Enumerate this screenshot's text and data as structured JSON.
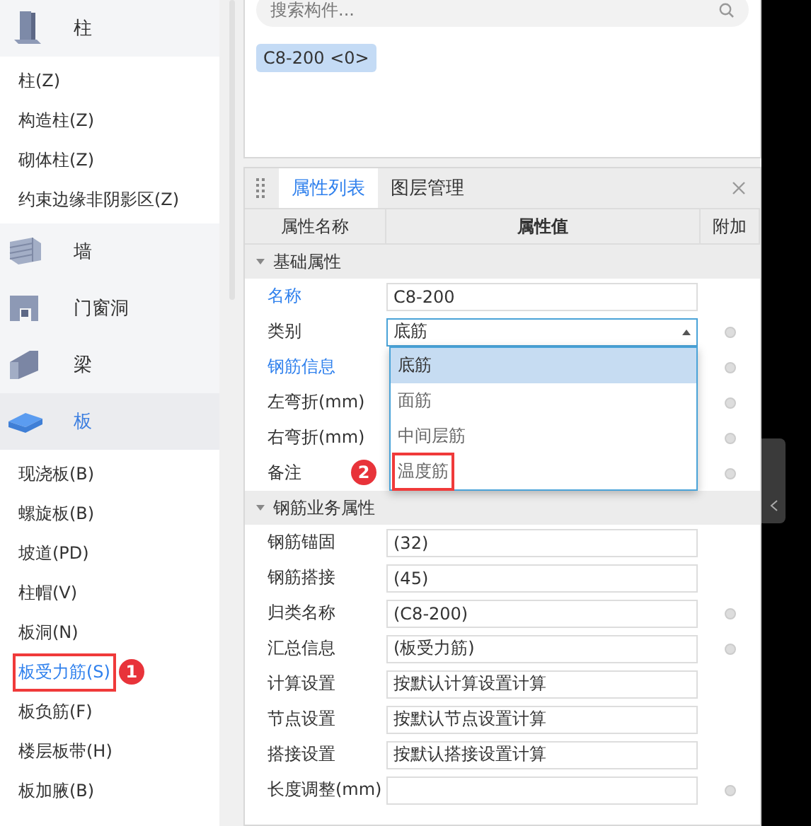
{
  "sidebar": {
    "categories": [
      {
        "label": "柱",
        "selected": false,
        "items": [
          {
            "label": "柱(Z)",
            "selected": false
          },
          {
            "label": "构造柱(Z)",
            "selected": false
          },
          {
            "label": "砌体柱(Z)",
            "selected": false
          },
          {
            "label": "约束边缘非阴影区(Z)",
            "selected": false
          }
        ]
      },
      {
        "label": "墙",
        "selected": false
      },
      {
        "label": "门窗洞",
        "selected": false
      },
      {
        "label": "梁",
        "selected": false
      },
      {
        "label": "板",
        "selected": true,
        "items": [
          {
            "label": "现浇板(B)",
            "selected": false
          },
          {
            "label": "螺旋板(B)",
            "selected": false
          },
          {
            "label": "坡道(PD)",
            "selected": false
          },
          {
            "label": "柱帽(V)",
            "selected": false
          },
          {
            "label": "板洞(N)",
            "selected": false
          },
          {
            "label": "板受力筋(S)",
            "selected": true,
            "marker": "1"
          },
          {
            "label": "板负筋(F)",
            "selected": false
          },
          {
            "label": "楼层板带(H)",
            "selected": false
          },
          {
            "label": "板加腋(B)",
            "selected": false
          }
        ]
      }
    ]
  },
  "component_list": {
    "search": {
      "placeholder": "搜索构件..."
    },
    "items": [
      {
        "label": "C8-200 <0>",
        "selected": true
      }
    ]
  },
  "property_panel": {
    "tabs": [
      {
        "label": "属性列表",
        "selected": true
      },
      {
        "label": "图层管理",
        "selected": false
      }
    ],
    "columns": [
      "属性名称",
      "属性值",
      "附加"
    ],
    "sections": [
      {
        "title": "基础属性",
        "expanded": true,
        "rows": [
          {
            "name": "名称",
            "linked": true,
            "kind": "input",
            "value": "C8-200"
          },
          {
            "name": "类别",
            "linked": false,
            "kind": "select",
            "value": "底筋",
            "extra": true,
            "options": [
              {
                "label": "底筋",
                "selected": true
              },
              {
                "label": "面筋",
                "selected": false
              },
              {
                "label": "中间层筋",
                "selected": false
              },
              {
                "label": "温度筋",
                "selected": false,
                "marker": "2"
              }
            ]
          },
          {
            "name": "钢筋信息",
            "linked": true,
            "kind": "covered",
            "extra": true
          },
          {
            "name": "左弯折(mm)",
            "linked": false,
            "kind": "covered",
            "extra": true
          },
          {
            "name": "右弯折(mm)",
            "linked": false,
            "kind": "covered",
            "extra": true
          },
          {
            "name": "备注",
            "linked": false,
            "kind": "covered",
            "extra": true
          }
        ]
      },
      {
        "title": "钢筋业务属性",
        "expanded": true,
        "rows": [
          {
            "name": "钢筋锚固",
            "linked": false,
            "kind": "input",
            "value": "(32)"
          },
          {
            "name": "钢筋搭接",
            "linked": false,
            "kind": "input",
            "value": "(45)"
          },
          {
            "name": "归类名称",
            "linked": false,
            "kind": "input",
            "value": "(C8-200)",
            "extra": true
          },
          {
            "name": "汇总信息",
            "linked": false,
            "kind": "input",
            "value": "(板受力筋)",
            "extra": true
          },
          {
            "name": "计算设置",
            "linked": false,
            "kind": "input",
            "value": "按默认计算设置计算"
          },
          {
            "name": "节点设置",
            "linked": false,
            "kind": "input",
            "value": "按默认节点设置计算"
          },
          {
            "name": "搭接设置",
            "linked": false,
            "kind": "input",
            "value": "按默认搭接设置计算"
          },
          {
            "name": "长度调整(mm)",
            "linked": false,
            "kind": "input",
            "extra": true
          }
        ]
      }
    ]
  }
}
